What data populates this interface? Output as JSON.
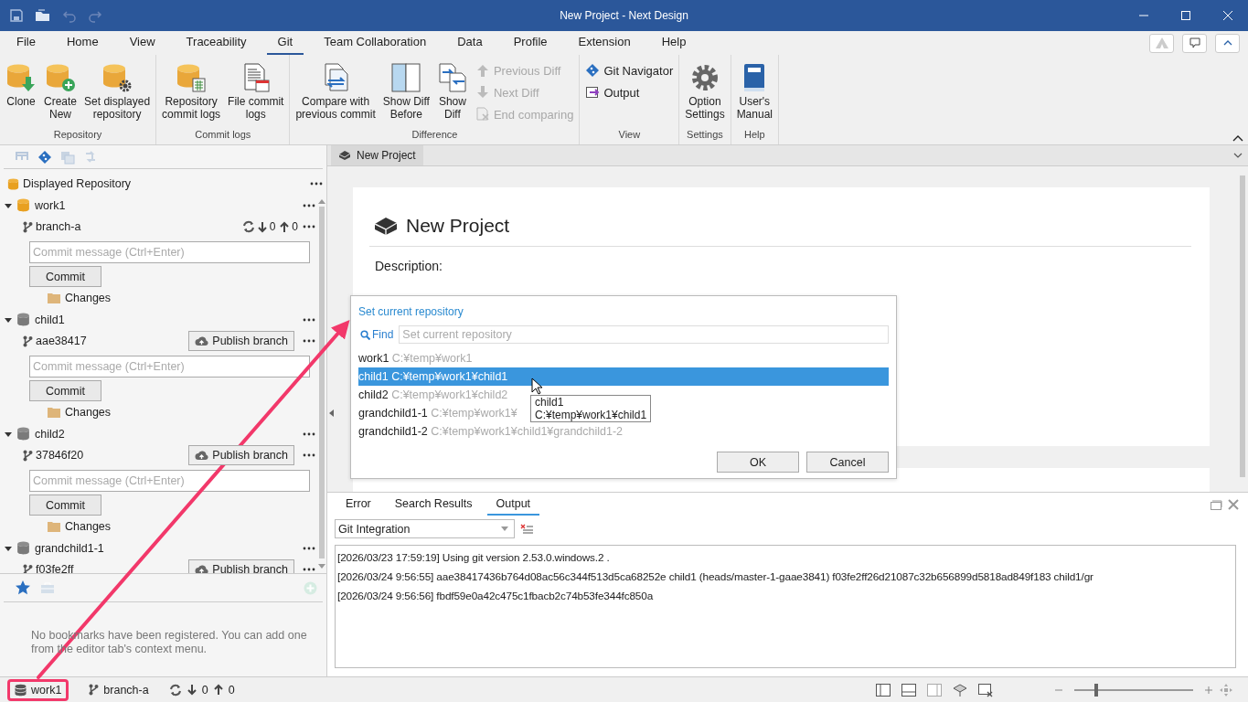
{
  "window": {
    "title": "New Project - Next Design"
  },
  "menu_tabs": [
    {
      "label": "File",
      "selected": false
    },
    {
      "label": "Home",
      "selected": false
    },
    {
      "label": "View",
      "selected": false
    },
    {
      "label": "Traceability",
      "selected": false
    },
    {
      "label": "Git",
      "selected": true
    },
    {
      "label": "Team Collaboration",
      "selected": false
    },
    {
      "label": "Data",
      "selected": false
    },
    {
      "label": "Profile",
      "selected": false
    },
    {
      "label": "Extension",
      "selected": false
    },
    {
      "label": "Help",
      "selected": false
    }
  ],
  "ribbon_groups": [
    {
      "label": "Repository",
      "items": [
        {
          "kind": "large",
          "label": "Clone",
          "disabled": false
        },
        {
          "kind": "large",
          "label": "Create\nNew",
          "disabled": false
        },
        {
          "kind": "large",
          "label": "Set displayed\nrepository",
          "disabled": false
        }
      ]
    },
    {
      "label": "Commit logs",
      "items": [
        {
          "kind": "large",
          "label": "Repository\ncommit logs",
          "disabled": false
        },
        {
          "kind": "large",
          "label": "File commit\nlogs",
          "disabled": false
        }
      ]
    },
    {
      "label": "Difference",
      "items": [
        {
          "kind": "large",
          "label": "Compare with\nprevious commit",
          "disabled": false
        },
        {
          "kind": "large",
          "label": "Show Diff\nBefore",
          "disabled": false
        },
        {
          "kind": "large",
          "label": "Show\nDiff",
          "disabled": false
        },
        {
          "kind": "small",
          "label": "Previous Diff",
          "disabled": true
        },
        {
          "kind": "small",
          "label": "Next Diff",
          "disabled": true
        },
        {
          "kind": "small",
          "label": "End comparing",
          "disabled": true
        }
      ]
    },
    {
      "label": "View",
      "items": [
        {
          "kind": "small",
          "label": "Git Navigator",
          "disabled": false
        },
        {
          "kind": "small",
          "label": "Output",
          "disabled": false
        }
      ]
    },
    {
      "label": "Settings",
      "items": [
        {
          "kind": "large",
          "label": "Option\nSettings",
          "disabled": false
        }
      ]
    },
    {
      "label": "Help",
      "items": [
        {
          "kind": "large",
          "label": "User's\nManual",
          "disabled": false
        }
      ]
    }
  ],
  "repo_panel": {
    "header": "Displayed Repository",
    "repositories": [
      {
        "name": "work1",
        "current": true,
        "expanded": true,
        "branch": "branch-a",
        "sync": {
          "incoming": "0",
          "outgoing": "0"
        },
        "commit_placeholder": "Commit message (Ctrl+Enter)",
        "commit_button": "Commit",
        "changes": "Changes"
      },
      {
        "name": "child1",
        "current": false,
        "expanded": true,
        "branch": "aae38417",
        "publish_button": "Publish branch",
        "commit_placeholder": "Commit message (Ctrl+Enter)",
        "commit_button": "Commit",
        "changes": "Changes"
      },
      {
        "name": "child2",
        "current": false,
        "expanded": true,
        "branch": "37846f20",
        "publish_button": "Publish branch",
        "commit_placeholder": "Commit message (Ctrl+Enter)",
        "commit_button": "Commit",
        "changes": "Changes"
      },
      {
        "name": "grandchild1-1",
        "current": false,
        "expanded": true,
        "branch": "f03fe2ff",
        "publish_button": "Publish branch"
      }
    ]
  },
  "bookmarks": {
    "tabs": [
      {
        "selected": true
      },
      {
        "selected": false
      }
    ],
    "empty_message": "No bookmarks have been registered. You can add one from the editor tab's context menu."
  },
  "editor": {
    "tab": "New Project",
    "title": "New Project",
    "description_label": "Description:"
  },
  "repo_picker": {
    "title": "Set current repository",
    "find_label": "Find",
    "search_placeholder": "Set current repository",
    "items": [
      {
        "name": "work1",
        "path": "C:¥temp¥work1",
        "selected": false
      },
      {
        "name": "child1",
        "path": "C:¥temp¥work1¥child1",
        "selected": true
      },
      {
        "name": "child2",
        "path": "C:¥temp¥work1¥child2",
        "selected": false
      },
      {
        "name": "grandchild1-1",
        "path": "C:¥temp¥work1¥",
        "selected": false
      },
      {
        "name": "grandchild1-2",
        "path": "C:¥temp¥work1¥child1¥grandchild1-2",
        "selected": false
      }
    ],
    "tooltip": [
      "child1",
      "C:¥temp¥work1¥child1"
    ],
    "buttons": [
      "OK",
      "Cancel"
    ]
  },
  "output_panel": {
    "tabs": [
      {
        "label": "Error",
        "selected": false
      },
      {
        "label": "Search Results",
        "selected": false
      },
      {
        "label": "Output",
        "selected": true
      }
    ],
    "source": "Git Integration",
    "lines": [
      "[2026/03/23 17:59:19] Using git version 2.53.0.windows.2 .",
      "[2026/03/24 9:56:55]  aae38417436b764d08ac56c344f513d5ca68252e child1 (heads/master-1-gaae3841)  f03fe2ff26d21087c32b656899d5818ad849f183 child1/gr",
      "[2026/03/24 9:56:56] fbdf59e0a42c475c1fbacb2c74b53fe344fc850a"
    ]
  },
  "status_bar": {
    "repository": "work1",
    "highlighted": true,
    "branch": "branch-a",
    "incoming": "0",
    "outgoing": "0",
    "zoom": {
      "level": 0.17
    }
  }
}
